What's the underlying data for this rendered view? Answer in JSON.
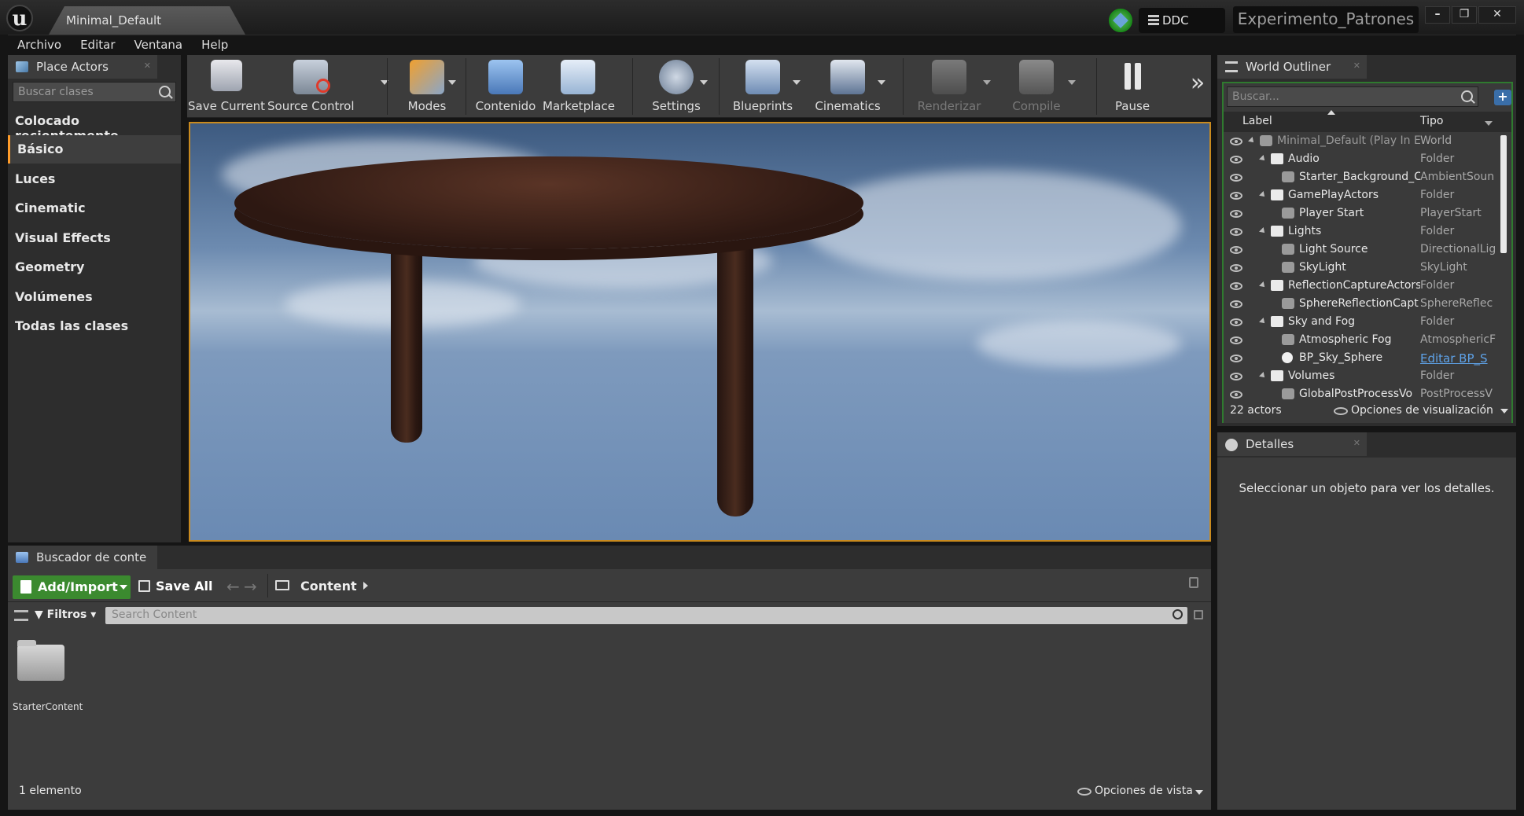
{
  "window": {
    "level_tab": "Minimal_Default",
    "ddc_label": "DDC",
    "project_name": "Experimento_Patrones",
    "minimize": "–",
    "restore": "❐",
    "close": "✕"
  },
  "menu": [
    "Archivo",
    "Editar",
    "Ventana",
    "Help"
  ],
  "place_actors": {
    "tab": "Place Actors",
    "search_placeholder": "Buscar clases",
    "categories": [
      "Colocado recientemente",
      "Básico",
      "Luces",
      "Cinematic",
      "Visual Effects",
      "Geometry",
      "Volúmenes",
      "Todas las clases"
    ],
    "selected": "Básico"
  },
  "toolbar": {
    "items": [
      {
        "label": "Save Current",
        "icon": "save-icon",
        "disabled": false
      },
      {
        "label": "Source Control",
        "icon": "source-control-icon",
        "disabled": false
      },
      {
        "label": "Modes",
        "icon": "modes-icon",
        "disabled": false
      },
      {
        "label": "Contenido",
        "icon": "content-icon",
        "disabled": false
      },
      {
        "label": "Marketplace",
        "icon": "marketplace-icon",
        "disabled": false
      },
      {
        "label": "Settings",
        "icon": "settings-icon",
        "disabled": false
      },
      {
        "label": "Blueprints",
        "icon": "blueprints-icon",
        "disabled": false
      },
      {
        "label": "Cinematics",
        "icon": "cinematics-icon",
        "disabled": false
      },
      {
        "label": "Renderizar",
        "icon": "build-icon",
        "disabled": true
      },
      {
        "label": "Compile",
        "icon": "compile-icon",
        "disabled": true
      },
      {
        "label": "Pause",
        "icon": "pause-icon",
        "disabled": false
      }
    ],
    "overflow": "»"
  },
  "outliner": {
    "tab": "World Outliner",
    "search_placeholder": "Buscar...",
    "col_label": "Label",
    "col_type": "Tipo",
    "rows": [
      {
        "label": "Minimal_Default (Play In E",
        "type": "World",
        "depth": 0,
        "kind": "world"
      },
      {
        "label": "Audio",
        "type": "Folder",
        "depth": 1,
        "kind": "folder"
      },
      {
        "label": "Starter_Background_C",
        "type": "AmbientSoun",
        "depth": 2,
        "kind": "actor"
      },
      {
        "label": "GamePlayActors",
        "type": "Folder",
        "depth": 1,
        "kind": "folder"
      },
      {
        "label": "Player Start",
        "type": "PlayerStart",
        "depth": 2,
        "kind": "actor"
      },
      {
        "label": "Lights",
        "type": "Folder",
        "depth": 1,
        "kind": "folder"
      },
      {
        "label": "Light Source",
        "type": "DirectionalLig",
        "depth": 2,
        "kind": "actor"
      },
      {
        "label": "SkyLight",
        "type": "SkyLight",
        "depth": 2,
        "kind": "actor"
      },
      {
        "label": "ReflectionCaptureActors",
        "type": "Folder",
        "depth": 1,
        "kind": "folder"
      },
      {
        "label": "SphereReflectionCapt",
        "type": "SphereReflec",
        "depth": 2,
        "kind": "actor"
      },
      {
        "label": "Sky and Fog",
        "type": "Folder",
        "depth": 1,
        "kind": "folder"
      },
      {
        "label": "Atmospheric Fog",
        "type": "AtmosphericF",
        "depth": 2,
        "kind": "actor"
      },
      {
        "label": "BP_Sky_Sphere",
        "type": "Editar BP_S",
        "depth": 2,
        "kind": "sphere",
        "link": true
      },
      {
        "label": "Volumes",
        "type": "Folder",
        "depth": 1,
        "kind": "folder"
      },
      {
        "label": "GlobalPostProcessVo",
        "type": "PostProcessV",
        "depth": 2,
        "kind": "actor"
      }
    ],
    "actor_count": "22 actors",
    "view_options": "Opciones de visualización"
  },
  "details": {
    "tab": "Detalles",
    "empty_message": "Seleccionar un objeto para ver los detalles."
  },
  "content_browser": {
    "tab": "Buscador de conte",
    "add_import": "Add/Import",
    "save_all": "Save All",
    "path": "Content",
    "filters": "Filtros",
    "search_placeholder": "Search Content",
    "items": [
      {
        "name": "StarterContent",
        "icon": "folder-icon"
      }
    ],
    "count": "1 elemento",
    "view_options": "Opciones de vista"
  },
  "colors": {
    "accent": "#ff9c2a",
    "viewport_border": "#c98a1e",
    "outliner_border": "#2f7a2f",
    "add_button": "#3b8a2f",
    "link": "#5ea2e8"
  }
}
